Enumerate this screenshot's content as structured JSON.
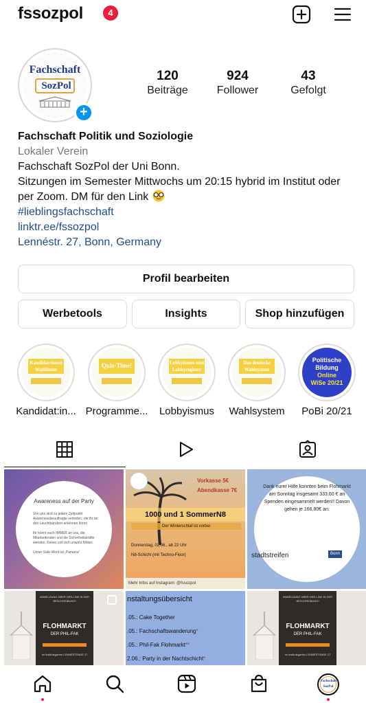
{
  "header": {
    "username": "fssozpol",
    "notification_count": "4",
    "icons": [
      "add-post-icon",
      "menu-icon"
    ]
  },
  "avatar": {
    "line1": "Fachschaft",
    "line2": "SozPol"
  },
  "stats": [
    {
      "value": "120",
      "label": "Beiträge"
    },
    {
      "value": "924",
      "label": "Follower"
    },
    {
      "value": "43",
      "label": "Gefolgt"
    }
  ],
  "bio": {
    "name": "Fachschaft Politik und Soziologie",
    "category": "Lokaler Verein",
    "line1": "Fachschaft SozPol der Uni Bonn.",
    "line2": "Sitzungen im Semester Mittwochs um 20:15 hybrid im Institut oder per Zoom. DM für den Link",
    "hashtag": "#lieblingsfachschaft",
    "link": "linktr.ee/fssozpol",
    "location": "Lennéstr. 27, Bonn, Germany"
  },
  "buttons": {
    "edit_profile": "Profil bearbeiten",
    "ad_tools": "Werbetools",
    "insights": "Insights",
    "add_shop": "Shop hinzufügen"
  },
  "highlights": [
    {
      "label": "Kandidat:in...",
      "cover": "Kandidat:innen Wahllisten"
    },
    {
      "label": "Programme...",
      "cover": "Quiz-Time!"
    },
    {
      "label": "Lobbyismus",
      "cover": "Lobbyismus und Lobbyregister"
    },
    {
      "label": "Wahlsystem",
      "cover": "Das deutsche Wahlsystem"
    },
    {
      "label": "PoBi 20/21",
      "cover_line1": "Politische",
      "cover_line2": "Bildung",
      "cover_line3": "Online",
      "cover_line4": "WiSe 20/21"
    }
  ],
  "tabs": [
    "grid-icon",
    "reels-icon",
    "tagged-icon"
  ],
  "posts": {
    "p1": {
      "title": "Awareness auf der Party",
      "items": [
        "Von uns sind zu jedem Zeitpunkt Awarenessbeauftragte vertreten, die ihr an den Leuchtbändern erkennen könnt",
        "Ihr könnt euch IMMER an uns, die Mitarbeitenden und die Sicherheitskräfte wenden. Keiner soll sich unwohl fühlen.",
        "Unser Safe-Word ist „Panama“"
      ]
    },
    "p2": {
      "kasse1": "Vorkasse 5€",
      "kasse2": "Abendkasse 7€",
      "title": "1000 und 1 SommerN8",
      "subtitle": "Der Winterschlaf ist vorbei",
      "date": "Donnerstag, 02.06., ab 22 Uhr",
      "floor": "N8-Schicht (mit Techno-Floor)",
      "footer": "Mehr Infos auf Instagram: @fssozpol"
    },
    "p3": {
      "text": "Dank eurer Hilfe konnten beim Flohmarkt am Sonntag insgesamt 333,60 € an Spenden eingesammelt werden!! Davon gehen je 166,80€ an:",
      "brand1": "stadtstreifen",
      "brand2": "Bonn"
    },
    "p4": {
      "small": "ANMELDUNG ÜBER DEN LINK IN DER BESCHREIBUNG!",
      "big": "FLOHMARKT",
      "mid": "DER PHIL-FAK",
      "addr": "im Institutsgarten LENNÉSTRAẞE 27"
    },
    "p5": {
      "heading": "nstaltungsübersicht",
      "rows": [
        ".05.: Cake Together",
        ".05.: Fachschaftswanderung",
        ".05.: Phil-Fak Flohmarkt",
        "2.06.: Party in der Nachtschicht"
      ],
      "marks": [
        "",
        "*",
        "**",
        "*"
      ]
    },
    "p6": {
      "small": "ANMELDUNG ÜBER DEN LINK IN DER BESCHREIBUNG!",
      "big": "FLOHMARKT",
      "mid": "DER PHIL-FAK",
      "addr": "im Institutsgarten LENNÉSTRAẞE 27"
    }
  },
  "bottom_nav": [
    "home-icon",
    "search-icon",
    "reels-icon",
    "shop-icon",
    "profile-avatar"
  ],
  "colors": {
    "accent": "#0095f6",
    "badge": "#ed1c3b",
    "link": "#1c4e8c"
  }
}
